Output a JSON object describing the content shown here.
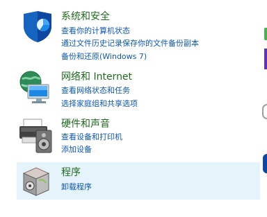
{
  "categories": [
    {
      "title": "系统和安全",
      "links": [
        "查看你的计算机状态",
        "通过文件历史记录保存你的文件备份副本",
        "备份和还原(Windows 7)"
      ],
      "icon": "security-shield-icon"
    },
    {
      "title": "网络和 Internet",
      "links": [
        "查看网络状态和任务",
        "选择家庭组和共享选项"
      ],
      "icon": "network-globe-icon"
    },
    {
      "title": "硬件和声音",
      "links": [
        "查看设备和打印机",
        "添加设备"
      ],
      "icon": "printer-speaker-icon"
    },
    {
      "title": "程序",
      "links": [
        "卸载程序"
      ],
      "icon": "programs-box-icon"
    }
  ],
  "colors": {
    "title": "#1e6b1e",
    "link": "#0b57b8",
    "hover_background": "#e5f3fb"
  }
}
